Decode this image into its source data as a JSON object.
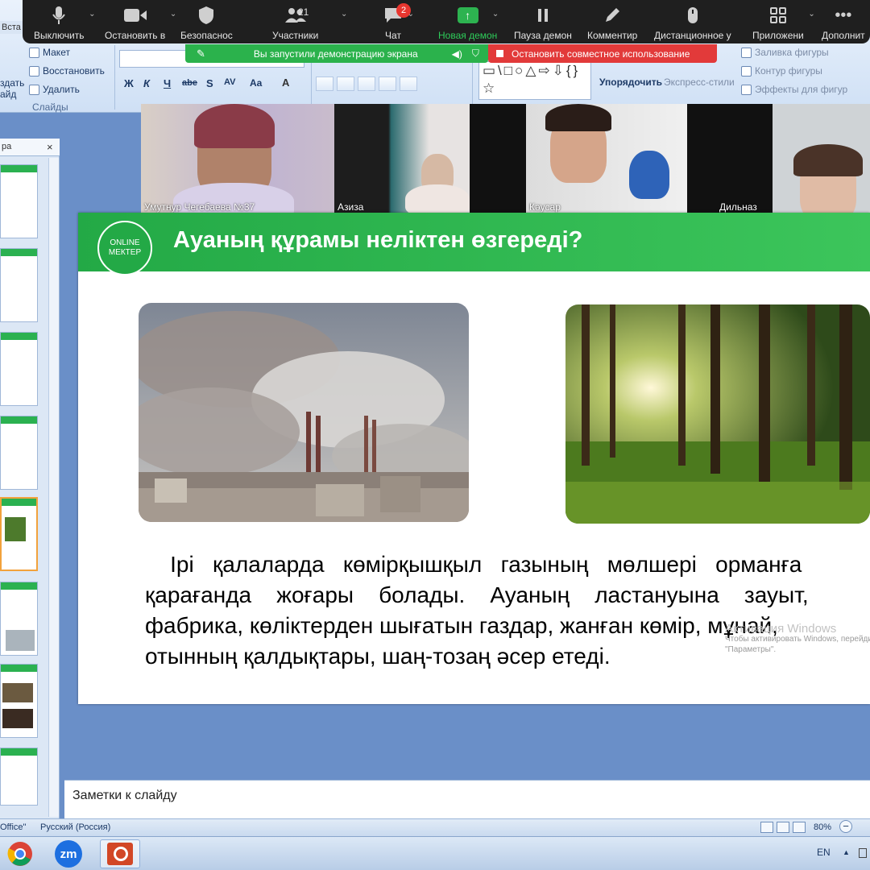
{
  "ribbon": {
    "insert_tab": "Вста",
    "create_slide": [
      "здать",
      "айд"
    ],
    "layout": "Макет",
    "restore": "Восстановить",
    "delete": "Удалить",
    "slides_group": "Слайды",
    "bold": "Ж",
    "italic": "К",
    "underline": "Ч",
    "strike": "abe",
    "shadow": "S",
    "spacing": "AV",
    "case": "Aa",
    "font_color": "A",
    "arrange": "Упорядочить",
    "express_styles": "Экспресс-стили",
    "shape_fill": "Заливка фигуры",
    "shape_outline": "Контур фигуры",
    "shape_effects": "Эффекты для фигур",
    "shapes_glyphs": "▭\\□○△⇨⇩{}☆"
  },
  "zoom_toolbar": {
    "mute": "Выключить",
    "stop_video": "Остановить в",
    "security": "Безопаснос",
    "participants": "Участники",
    "participants_count": "21",
    "chat": "Чат",
    "chat_badge": "2",
    "new_share": "Новая демон",
    "pause_share": "Пауза демон",
    "annotate": "Комментир",
    "remote": "Дистанционное у",
    "apps": "Приложени",
    "more": "Дополнит"
  },
  "share_bar": {
    "sharing_notice": "Вы запустили демонстрацию экрана",
    "stop_share": "Остановить совместное использование"
  },
  "participants": [
    {
      "name": "Умутнур Чегебаева №37"
    },
    {
      "name": "Азиза"
    },
    {
      "name": "Кәусар"
    },
    {
      "name": "Дильназ"
    }
  ],
  "slide": {
    "logo_line1": "ONLINE",
    "logo_line2": "МЕКТЕР",
    "title": "Ауаның құрамы неліктен өзгереді?",
    "text_lines": [
      "    Ірі   қалаларда   көмірқышқыл   газының   мөлшері   орманға",
      "қарағанда    жоғары    болады.    Ауаның    ластануына    зауыт,",
      "фабрика, көліктерден шығатын газдар, жанған көмір, мұнай,",
      "отынның қалдықтары, шаң-тозаң әсер етеді."
    ],
    "activation_title": "Активация Windows",
    "activation_line1": "Чтобы активировать Windows, перейдите",
    "activation_line2": "\"Параметры\"."
  },
  "panel": {
    "tab_label": "ра",
    "close": "×"
  },
  "notes": {
    "placeholder": "Заметки к слайду"
  },
  "status": {
    "theme": "Office\"",
    "language": "Русский (Россия)",
    "zoom": "80%"
  },
  "taskbar": {
    "zoom_app": "zm",
    "lang": "EN",
    "tray_arrow": "▲"
  },
  "colors": {
    "accent_green": "#2bb150",
    "stop_red": "#e23a3a",
    "ribbon_blue": "#cfe0f5"
  }
}
